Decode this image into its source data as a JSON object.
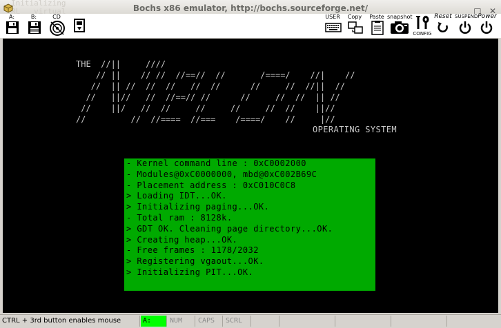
{
  "window": {
    "title": "Bochs x86 emulator, http://bochs.sourceforge.net/",
    "ghost_text": "Initializing\nRL   virtual"
  },
  "toolbar": {
    "floppy_a_label": "A:",
    "floppy_b_label": "B:",
    "cdrom_label": "CD",
    "user_label": "USER",
    "copy_label": "Copy",
    "paste_label": "Paste",
    "snapshot_label": "snapshot",
    "config_label": "CONFIG",
    "reset_label": "Reset",
    "suspend_label": "SUSPEND",
    "power_label": "Power"
  },
  "screen": {
    "ascii_art": "THE  //||     ////\n    // ||    // //  //==//  //       /====/    //|    //\n   //  || //  //  //   //  //      //     //  //||  //\n  //   ||//   //  //==// //      //     //  //  || //\n //    ||/   //  //     //     //     //  //    ||//\n//         //  //====  //===    /====/    //     |//",
    "os_label": "OPERATING SYSTEM",
    "kernel_lines": [
      "- Kernel command line : 0xC0002000",
      "- Modules@0xC0000000, mbd@0xC002B69C",
      "- Placement address : 0xC010C0C8",
      "> Loading IDT...OK.",
      "> Initializing paging...OK.",
      "- Total ram : 8128k.",
      "> GDT OK. Cleaning page directory...OK.",
      "> Creating heap...OK.",
      "- Free frames : 1178/2032",
      "> Registering vgaout...OK.",
      "> Initializing PIT...OK."
    ]
  },
  "statusbar": {
    "hint": "CTRL + 3rd button enables mouse",
    "drive_a": "A:",
    "num": "NUM",
    "caps": "CAPS",
    "scrl": "SCRL"
  },
  "colors": {
    "kernel_box": "#00aa00",
    "active_indicator": "#00ff00",
    "screen_bg": "#000000"
  }
}
